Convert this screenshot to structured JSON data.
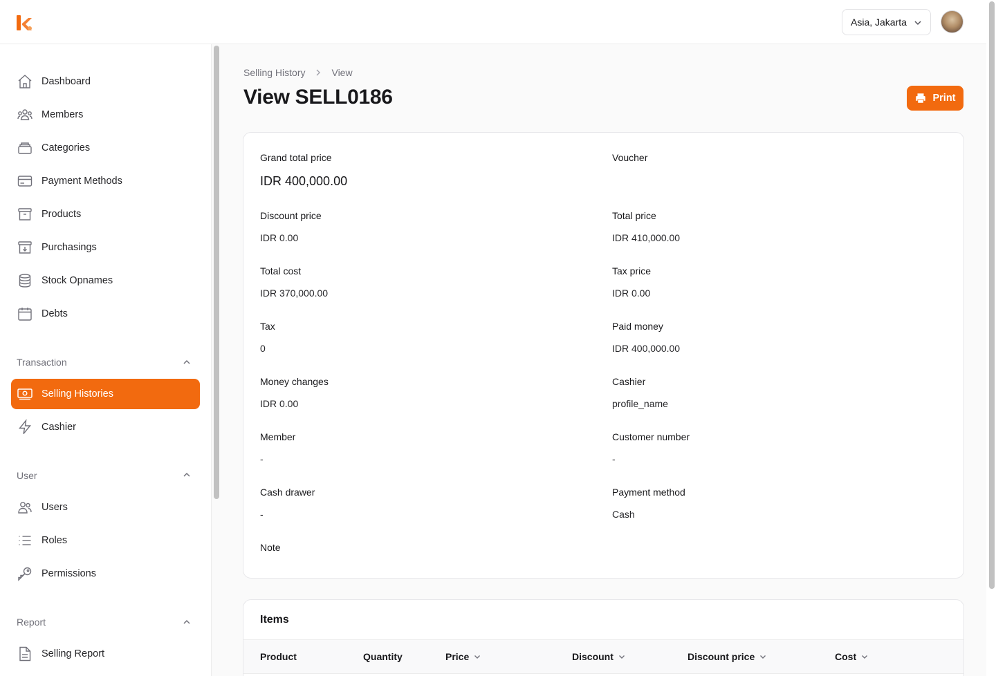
{
  "header": {
    "timezone": "Asia, Jakarta",
    "avatar_alt": "user avatar"
  },
  "sidebar": {
    "items": [
      {
        "label": "Dashboard",
        "icon": "home-icon"
      },
      {
        "label": "Members",
        "icon": "members-icon"
      },
      {
        "label": "Categories",
        "icon": "categories-icon"
      },
      {
        "label": "Payment Methods",
        "icon": "credit-card-icon"
      },
      {
        "label": "Products",
        "icon": "archive-box-icon"
      },
      {
        "label": "Purchasings",
        "icon": "archive-down-icon"
      },
      {
        "label": "Stock Opnames",
        "icon": "database-icon"
      },
      {
        "label": "Debts",
        "icon": "calendar-icon"
      }
    ],
    "groups": {
      "transaction": {
        "label": "Transaction",
        "items": [
          {
            "label": "Selling Histories",
            "icon": "banknote-icon",
            "active": true
          },
          {
            "label": "Cashier",
            "icon": "bolt-icon"
          }
        ]
      },
      "user": {
        "label": "User",
        "items": [
          {
            "label": "Users",
            "icon": "users-icon"
          },
          {
            "label": "Roles",
            "icon": "list-icon"
          },
          {
            "label": "Permissions",
            "icon": "key-icon"
          }
        ]
      },
      "report": {
        "label": "Report",
        "items": [
          {
            "label": "Selling Report",
            "icon": "document-icon"
          }
        ]
      }
    }
  },
  "breadcrumb": {
    "parent": "Selling History",
    "current": "View"
  },
  "page": {
    "title": "View SELL0186",
    "print_label": "Print"
  },
  "details": {
    "grand_total_label": "Grand total price",
    "grand_total": "IDR 400,000.00",
    "voucher_label": "Voucher",
    "voucher": "",
    "discount_price_label": "Discount price",
    "discount_price": "IDR 0.00",
    "total_price_label": "Total price",
    "total_price": "IDR 410,000.00",
    "total_cost_label": "Total cost",
    "total_cost": "IDR 370,000.00",
    "tax_price_label": "Tax price",
    "tax_price": "IDR 0.00",
    "tax_label": "Tax",
    "tax": "0",
    "paid_money_label": "Paid money",
    "paid_money": "IDR 400,000.00",
    "money_changes_label": "Money changes",
    "money_changes": "IDR 0.00",
    "cashier_label": "Cashier",
    "cashier": "profile_name",
    "member_label": "Member",
    "member": "-",
    "customer_number_label": "Customer number",
    "customer_number": "-",
    "cash_drawer_label": "Cash drawer",
    "cash_drawer": "-",
    "payment_method_label": "Payment method",
    "payment_method": "Cash",
    "note_label": "Note"
  },
  "items": {
    "title": "Items",
    "columns": [
      "Product",
      "Quantity",
      "Price",
      "Discount",
      "Discount price",
      "Cost"
    ]
  },
  "colors": {
    "accent": "#f26a0f"
  }
}
